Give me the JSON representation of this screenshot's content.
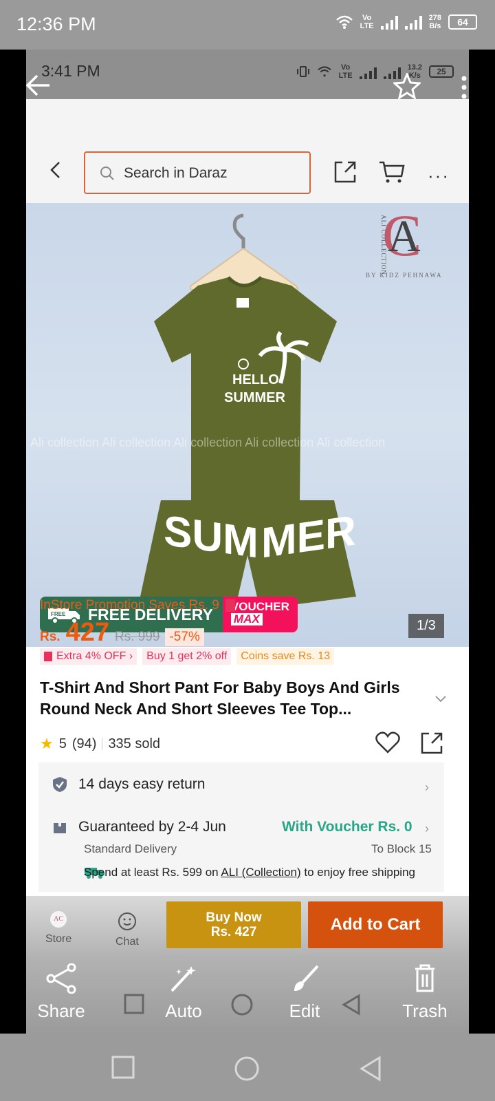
{
  "outer_status": {
    "time": "12:36 PM",
    "net_top": "Vo",
    "net_bottom": "LTE",
    "speed_top": "278",
    "speed_bottom": "B/s",
    "battery": "64"
  },
  "inner_status": {
    "time": "3:41 PM",
    "net_top": "Vo",
    "net_bottom": "LTE",
    "speed_top": "13.2",
    "speed_bottom": "K/s",
    "battery": "25"
  },
  "header": {
    "search_placeholder": "Search in Daraz"
  },
  "product_image": {
    "brand_vertical": "ALI COLLECTION",
    "brand_sub": "BY KIDZ PEHNAWA",
    "tshirt_line1": "HELLO",
    "tshirt_line2": "SUMMER",
    "shorts_left": "SUM",
    "shorts_right": "MER",
    "watermark": "Ali collection Ali collection Ali collection Ali collection Ali collection",
    "free_delivery_small": "FREE",
    "free_delivery": "FREE DELIVERY",
    "voucher_top": "VOUCHER",
    "voucher_bottom": "MAX",
    "page_count": "1/3"
  },
  "product": {
    "promo": "InStore Promotion Saves Rs. 9",
    "currency": "Rs.",
    "price": "427",
    "old_price": "Rs. 999",
    "discount": "-57%",
    "tags": [
      "Extra 4% OFF",
      "Buy 1 get 2% off",
      "Coins save Rs. 13"
    ],
    "title": "T-Shirt And Short Pant For Baby Boys And Girls Round Neck And Short Sleeves Tee Top...",
    "rating": "5",
    "reviews": "(94)",
    "sold": "335 sold"
  },
  "benefits": {
    "return": "14 days easy return",
    "guarantee": "Guaranteed by 2-4 Jun",
    "voucher": "With Voucher Rs. 0",
    "delivery_type": "Standard Delivery",
    "block": "To Block 15",
    "spend_prefix": "Spend at least Rs. 599 on ",
    "spend_store": "ALI (Collection)",
    "spend_suffix": " to enjoy free shipping"
  },
  "bottom_bar": {
    "store_label": "Store",
    "chat_label": "Chat",
    "buy_now_line1": "Buy Now",
    "buy_now_line2": "Rs. 427",
    "add_to_cart": "Add to Cart"
  },
  "gallery_toolbar": {
    "share": "Share",
    "auto": "Auto",
    "edit": "Edit",
    "trash": "Trash"
  },
  "colors": {
    "daraz_orange": "#f05a0f",
    "voucher_green": "#2aa587",
    "shirt_olive": "#5f6a2c"
  }
}
